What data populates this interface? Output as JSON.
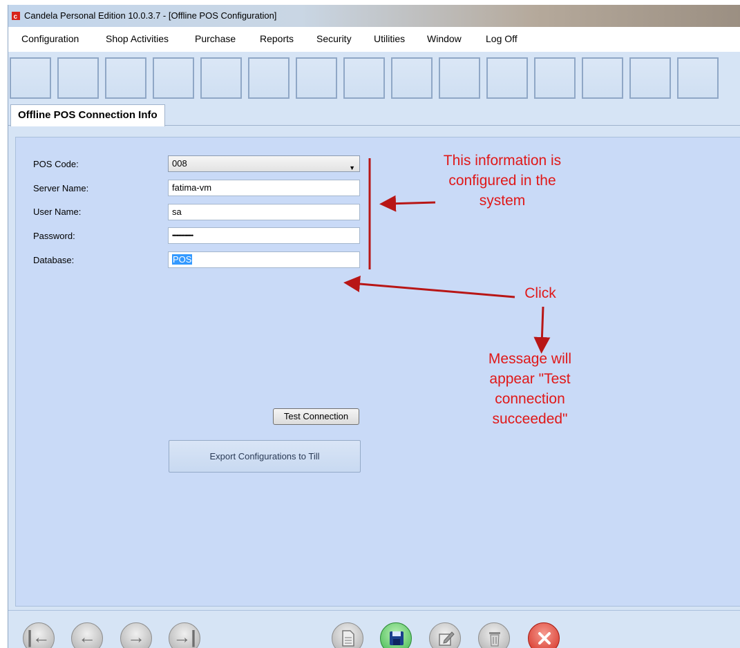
{
  "window": {
    "title": "Candela Personal Edition 10.0.3.7 - [Offline POS Configuration]",
    "icon": "candela-app-icon"
  },
  "menu": {
    "items": [
      "Configuration",
      "Shop Activities",
      "Purchase",
      "Reports",
      "Security",
      "Utilities",
      "Window",
      "Log Off"
    ]
  },
  "tab": {
    "label": "Offline POS Connection Info"
  },
  "form": {
    "pos_code": {
      "label": "POS Code:",
      "value": "008"
    },
    "server_name": {
      "label": "Server Name:",
      "value": "fatima-vm"
    },
    "user_name": {
      "label": "User Name:",
      "value": "sa"
    },
    "password": {
      "label": "Password:",
      "value": "••••••••••••••"
    },
    "database": {
      "label": "Database:",
      "value": "POS"
    },
    "test_connection_label": "Test Connection",
    "export_label": "Export Configurations to Till"
  },
  "annotations": {
    "configured_line1": "This information is",
    "configured_line2": "configured in the",
    "configured_line3": "system",
    "click": "Click",
    "message_line1": "Message will",
    "message_line2": "appear \"Test",
    "message_line3": "connection",
    "message_line4": "succeeded\"",
    "color": "#e01818"
  },
  "navigation": {
    "buttons": [
      "first-record-icon",
      "previous-record-icon",
      "next-record-icon",
      "last-record-icon",
      "new-document-icon",
      "save-disk-icon",
      "edit-icon",
      "delete-trash-icon",
      "close-x-icon"
    ]
  },
  "colors": {
    "background": "#d6e4f5",
    "panel": "#c9daf7",
    "selection": "#3399ff",
    "save_green": "#3db54a",
    "close_red": "#d42a1e"
  }
}
